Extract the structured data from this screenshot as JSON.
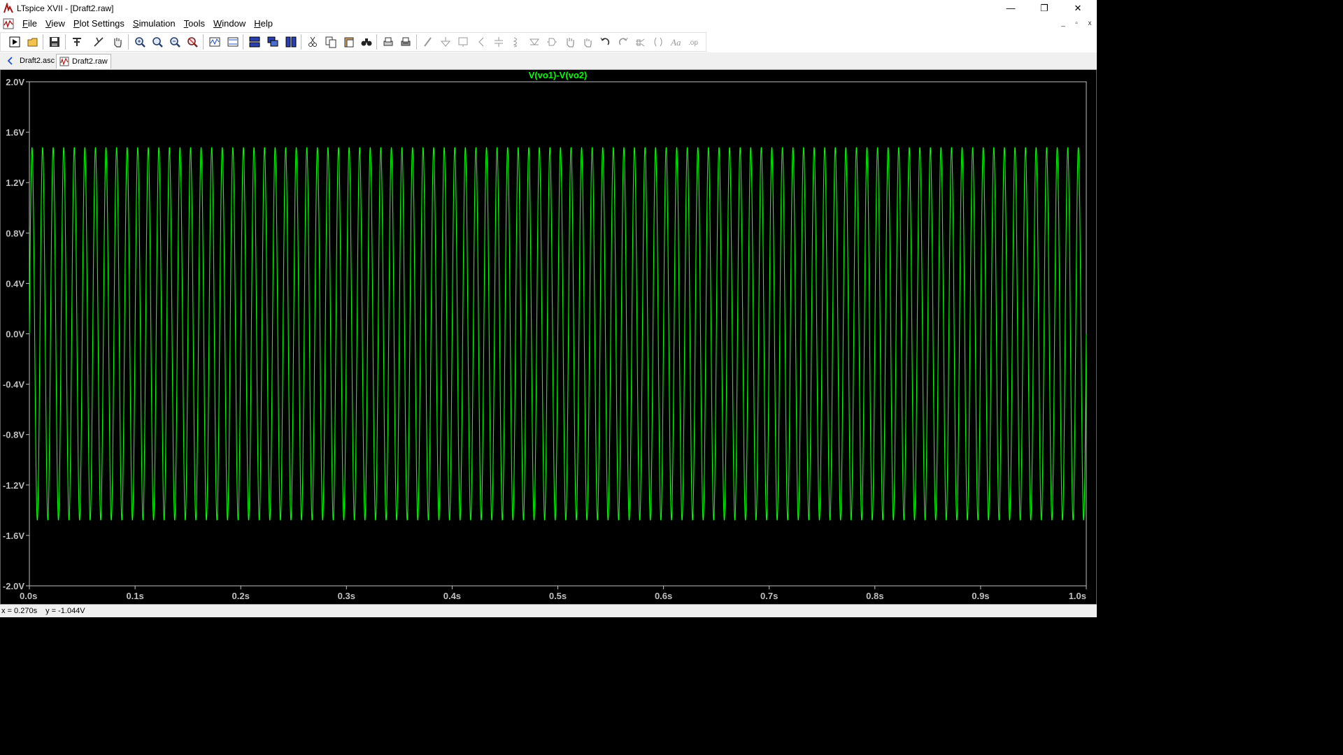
{
  "window": {
    "title": "LTspice XVII - [Draft2.raw]"
  },
  "window_controls": {
    "minimize": "—",
    "restore": "❐",
    "close": "✕"
  },
  "mdi_controls": {
    "minimize": "_",
    "restore": "▫",
    "close": "x"
  },
  "menu": [
    "File",
    "View",
    "Plot Settings",
    "Simulation",
    "Tools",
    "Window",
    "Help"
  ],
  "menu_mnemonics": [
    "F",
    "V",
    "P",
    "S",
    "T",
    "W",
    "H"
  ],
  "toolbar": {
    "icons": [
      "run-icon",
      "open-icon",
      "save-icon",
      "control-panel-icon",
      "halt-icon",
      "pan-hand-icon",
      "zoom-in-icon",
      "zoom-area-icon",
      "zoom-out-icon",
      "zoom-fit-icon",
      "autorange-icon",
      "manual-limits-icon",
      "tile-horizontal-icon",
      "cascade-icon",
      "tile-vertical-icon",
      "cut-icon",
      "copy-icon",
      "paste-icon",
      "find-icon",
      "print-icon",
      "print-setup-icon",
      "wire-icon",
      "ground-icon",
      "label-icon",
      "resistor-icon",
      "capacitor-icon",
      "inductor-icon",
      "diode-icon",
      "component-icon",
      "move-icon",
      "drag-icon",
      "undo-icon",
      "redo-icon",
      "rotate-icon",
      "mirror-icon",
      "text-icon",
      "spice-directive-icon"
    ]
  },
  "tabs": [
    {
      "label": "Draft2.asc",
      "icon": "schematic-icon",
      "active": false
    },
    {
      "label": "Draft2.raw",
      "icon": "waveform-icon",
      "active": true
    }
  ],
  "status": {
    "x": "x = 0.270s",
    "y": "y = -1.044V"
  },
  "colors": {
    "trace": "#00ff00",
    "grid_axis": "#c0c0c0",
    "label": "#c0c0c0",
    "background": "#000000"
  },
  "chart_data": {
    "type": "line",
    "title": "V(vo1)-V(vo2)",
    "xlabel": "",
    "ylabel": "",
    "xlim": [
      0.0,
      1.0
    ],
    "ylim": [
      -2.0,
      2.0
    ],
    "x_ticks": [
      "0.0s",
      "0.1s",
      "0.2s",
      "0.3s",
      "0.4s",
      "0.5s",
      "0.6s",
      "0.7s",
      "0.8s",
      "0.9s",
      "1.0s"
    ],
    "y_ticks": [
      "2.0V",
      "1.6V",
      "1.2V",
      "0.8V",
      "0.4V",
      "0.0V",
      "-0.4V",
      "-0.8V",
      "-1.2V",
      "-1.6V",
      "-2.0V"
    ],
    "grid": false,
    "series": [
      {
        "name": "V(vo1)-V(vo2)",
        "waveform": "sine",
        "amplitude_V": 1.48,
        "offset_V": 0.0,
        "frequency_Hz": 100,
        "t_start_s": 0.0,
        "t_end_s": 1.0
      }
    ]
  }
}
